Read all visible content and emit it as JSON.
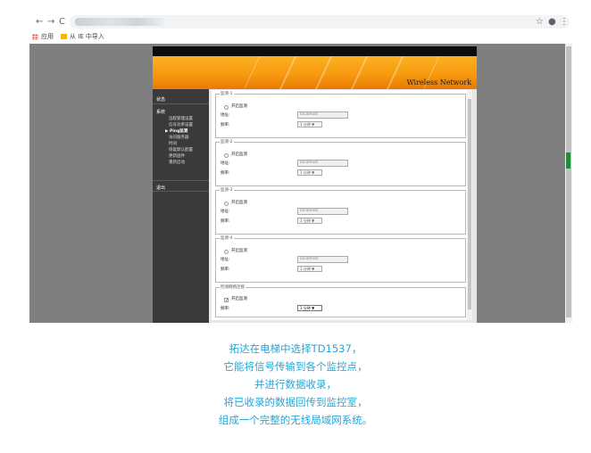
{
  "browser": {
    "back_icon": "←",
    "forward_icon": "→",
    "reload_icon": "C",
    "star_icon": "☆",
    "account_icon": "●",
    "menu_icon": "⋮",
    "bookmarks": [
      {
        "label": "应用",
        "icon": "apps-icon"
      },
      {
        "label": "从 IE 中导入",
        "icon": "folder-icon"
      }
    ]
  },
  "router": {
    "brand_title": "Wireless Network",
    "sidebar": {
      "sections": [
        {
          "label": "状态"
        },
        {
          "label": "系统"
        },
        {
          "label": "退出"
        }
      ],
      "system_items": [
        {
          "label": "远程管理设置",
          "active": false
        },
        {
          "label": "信号功率设置",
          "active": false
        },
        {
          "label": "Ping监测",
          "active": true
        },
        {
          "label": "访问服务器",
          "active": false
        },
        {
          "label": "时间",
          "active": false
        },
        {
          "label": "恢复默认配置",
          "active": false
        },
        {
          "label": "更新固件",
          "active": false
        },
        {
          "label": "重新启动",
          "active": false
        }
      ]
    },
    "monitors": [
      {
        "legend": "监测-1",
        "enable_label": "开启监测",
        "address_label": "地址:",
        "address_value": "localhost",
        "freq_label": "频率:",
        "freq_value": "1 分钟 ▼"
      },
      {
        "legend": "监测-2",
        "enable_label": "开启监测",
        "address_label": "地址:",
        "address_value": "localhost",
        "freq_label": "频率:",
        "freq_value": "1 分钟 ▼"
      },
      {
        "legend": "监测-3",
        "enable_label": "开启监测",
        "address_label": "地址:",
        "address_value": "localhost",
        "freq_label": "频率:",
        "freq_value": "1 分钟 ▼"
      },
      {
        "legend": "监测-4",
        "enable_label": "开启监测",
        "address_label": "地址:",
        "address_value": "localhost",
        "freq_label": "频率:",
        "freq_value": "1 分钟 ▼"
      }
    ],
    "detector": {
      "legend": "检测网络连接",
      "enable_label": "开启监测",
      "checked": true,
      "freq_label": "频率:",
      "freq_value": "3 分钟 ▼"
    }
  },
  "caption": {
    "lines": [
      "拓达在电梯中选择TD1537，",
      "它能将信号传输到各个监控点，",
      "并进行数据收录，",
      "将已收录的数据回传到监控室，",
      "组成一个完整的无线局域网系统。"
    ]
  },
  "colors": {
    "banner_orange": "#f79a0f",
    "sidebar_dark": "#3a3a3a",
    "caption_blue": "#26a6d9"
  }
}
